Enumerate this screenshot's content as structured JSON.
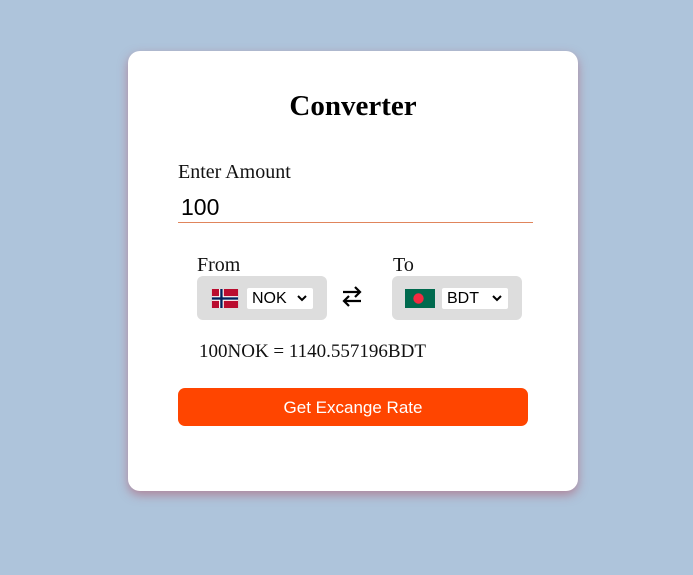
{
  "converter": {
    "title": "Converter",
    "amount_label": "Enter Amount",
    "amount_value": "100",
    "from_label": "From",
    "to_label": "To",
    "from_currency": "NOK",
    "to_currency": "BDT",
    "from_flag_icon": "norway-flag-icon",
    "to_flag_icon": "bangladesh-flag-icon",
    "swap_icon": "swap-arrows-icon",
    "result_text": "100NOK = 1140.557196BDT",
    "button_label": "Get Excange Rate"
  },
  "colors": {
    "page_background": "#aec4db",
    "card_background": "#ffffff",
    "accent": "#ff4500",
    "select_background": "#dddddd",
    "input_underline": "#e0855c"
  }
}
